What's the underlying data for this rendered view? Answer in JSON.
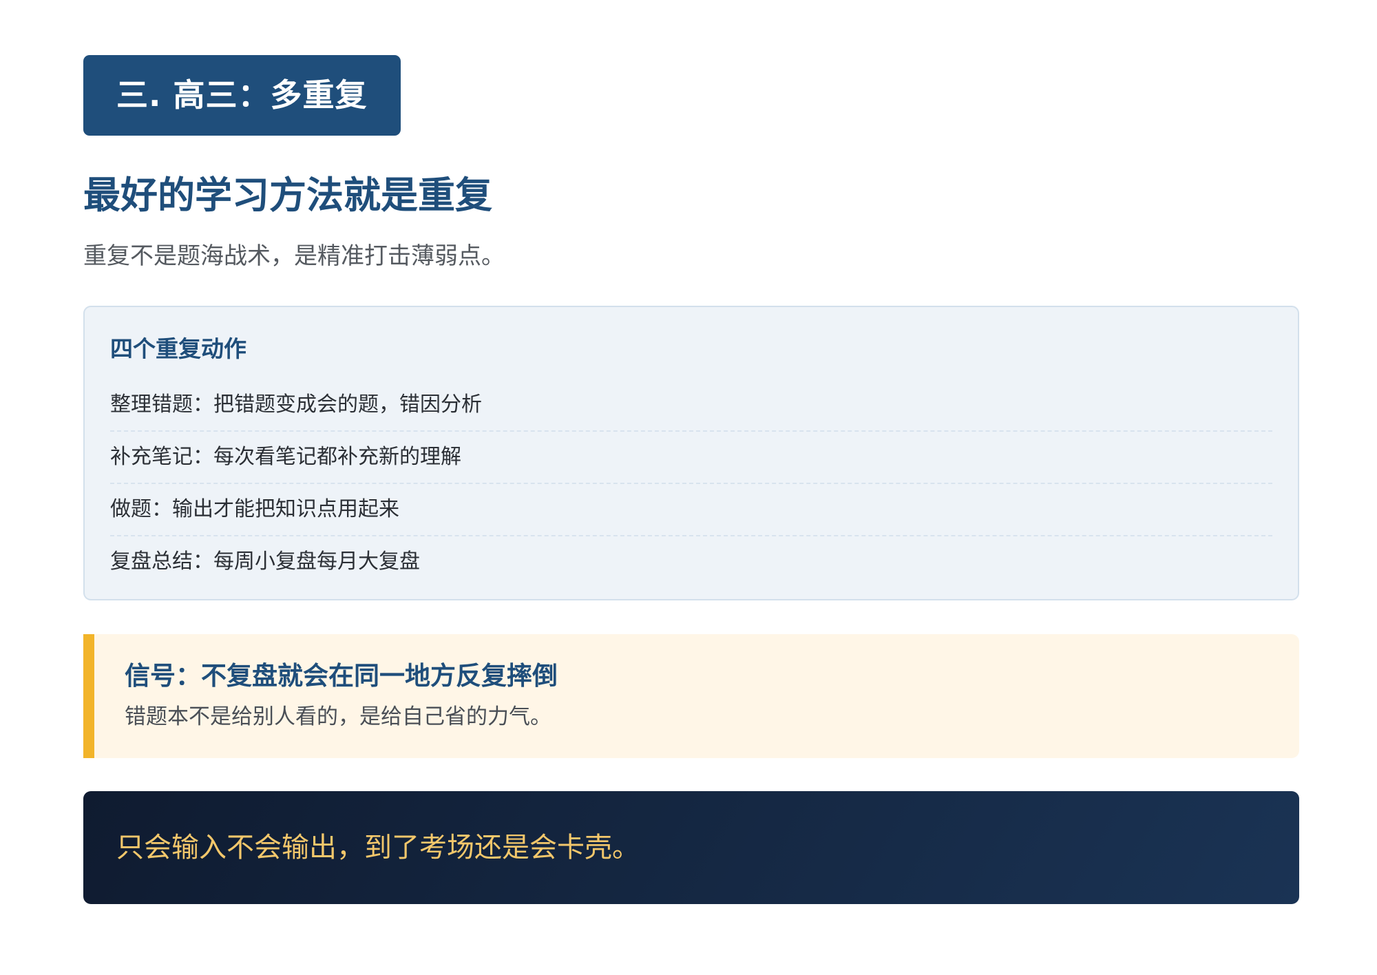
{
  "section": {
    "badge": "三. 高三：多重复"
  },
  "main": {
    "heading": "最好的学习方法就是重复",
    "subtitle": "重复不是题海战术，是精准打击薄弱点。"
  },
  "actions": {
    "title": "四个重复动作",
    "items": [
      "整理错题：把错题变成会的题，错因分析",
      "补充笔记：每次看笔记都补充新的理解",
      "做题：输出才能把知识点用起来",
      "复盘总结：每周小复盘每月大复盘"
    ]
  },
  "signal": {
    "title": "信号：不复盘就会在同一地方反复摔倒",
    "text": "错题本不是给别人看的，是给自己省的力气。"
  },
  "banner": {
    "text": "只会输入不会输出，到了考场还是会卡壳。"
  },
  "colors": {
    "primary": "#1f4e7b",
    "accent": "#f2b42a",
    "banner_text": "#f3c76b",
    "banner_bg": "#0f1b30"
  }
}
